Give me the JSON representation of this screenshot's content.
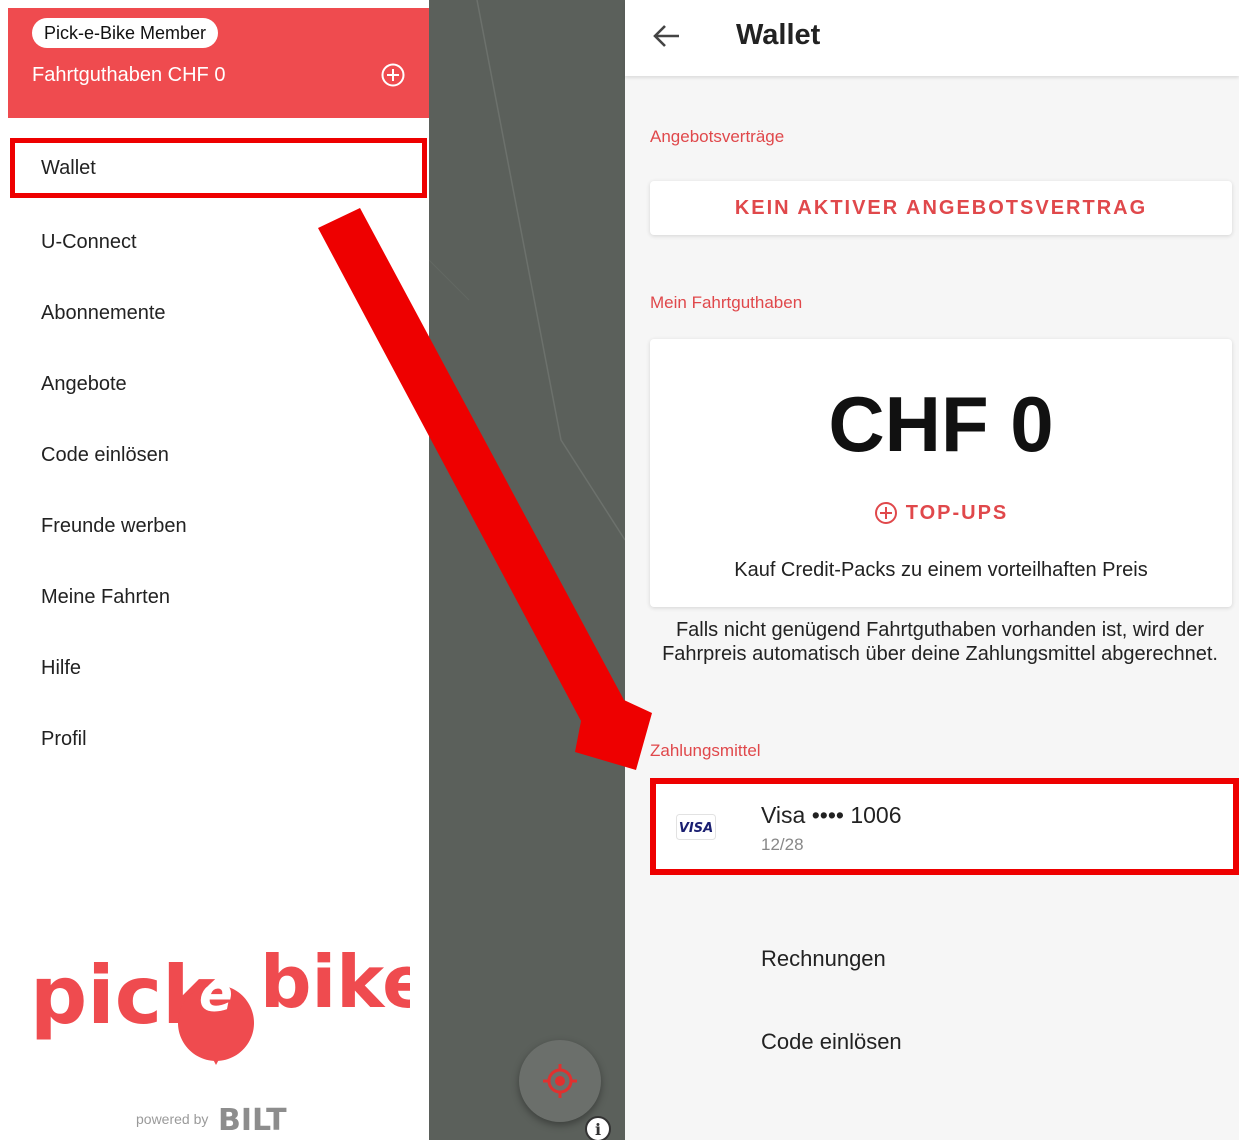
{
  "drawer": {
    "member_badge": "Pick-e-Bike Member",
    "balance": "Fahrtguthaben CHF 0",
    "add_credit_icon": "plus-circle-icon",
    "items": [
      {
        "label": "Wallet",
        "active": true
      },
      {
        "label": "U-Connect"
      },
      {
        "label": "Abonnemente"
      },
      {
        "label": "Angebote"
      },
      {
        "label": "Code einlösen"
      },
      {
        "label": "Freunde werben"
      },
      {
        "label": "Meine Fahrten"
      },
      {
        "label": "Hilfe"
      },
      {
        "label": "Profil"
      }
    ],
    "logo": {
      "word_left": "pick",
      "word_middle": "e",
      "word_right": "bike"
    },
    "powered_by": "powered by",
    "partner_logo": "BILT"
  },
  "map": {
    "locate_icon": "crosshair-target-icon",
    "info_label": "i"
  },
  "wallet": {
    "title": "Wallet",
    "back_icon": "arrow-left-icon",
    "contracts_label": "Angebotsverträge",
    "contract_status": "KEIN AKTIVER ANGEBOTSVERTRAG",
    "balance_label": "Mein Fahrtguthaben",
    "balance_amount": "CHF 0",
    "topups_label": "TOP-UPS",
    "packs_text": "Kauf Credit-Packs zu einem vorteilhaften Preis",
    "info_note": "Falls nicht genügend Fahrtguthaben vorhanden ist, wird der Fahrpreis automatisch über deine Zahlungsmittel abgerechnet.",
    "payment_label": "Zahlungsmittel",
    "card": {
      "brand": "VISA",
      "name": "Visa •••• 1006",
      "expiry": "12/28"
    },
    "links": [
      "Rechnungen",
      "Code einlösen"
    ]
  },
  "colors": {
    "brand_red": "#ef4b4f",
    "accent_red": "#e0484b",
    "highlight_red": "#ee0000",
    "map_gray": "#5b605b"
  }
}
